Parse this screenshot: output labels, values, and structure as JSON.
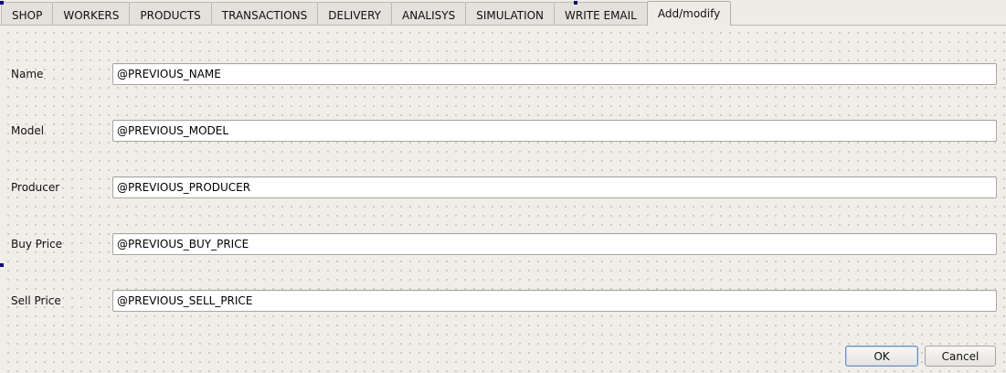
{
  "tabs": [
    {
      "label": "SHOP"
    },
    {
      "label": "WORKERS"
    },
    {
      "label": "PRODUCTS"
    },
    {
      "label": "TRANSACTIONS"
    },
    {
      "label": "DELIVERY"
    },
    {
      "label": "ANALISYS"
    },
    {
      "label": "SIMULATION"
    },
    {
      "label": "WRITE EMAIL"
    },
    {
      "label": "Add/modify",
      "active": true
    }
  ],
  "form": {
    "name": {
      "label": "Name",
      "value": "@PREVIOUS_NAME"
    },
    "model": {
      "label": "Model",
      "value": "@PREVIOUS_MODEL"
    },
    "producer": {
      "label": "Producer",
      "value": "@PREVIOUS_PRODUCER"
    },
    "buy_price": {
      "label": "Buy Price",
      "value": "@PREVIOUS_BUY_PRICE"
    },
    "sell_price": {
      "label": "Sell Price",
      "value": "@PREVIOUS_SELL_PRICE"
    }
  },
  "buttons": {
    "ok": "OK",
    "cancel": "Cancel"
  },
  "colors": {
    "background": "#efebe7",
    "selection_handle": "#0a0a7a",
    "default_button_border": "#6f8fb8"
  }
}
